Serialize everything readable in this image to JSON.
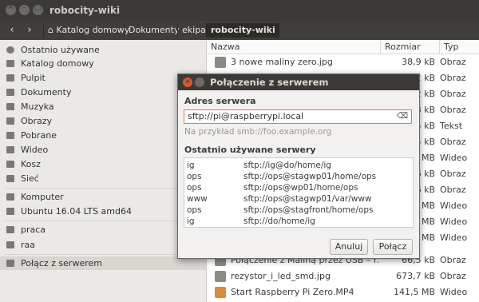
{
  "window": {
    "title": "robocity-wiki"
  },
  "pathbar": {
    "back": "‹",
    "forward": "›",
    "crumbs": [
      "Katalog domowy",
      "Dokumenty",
      "ekipa",
      "robocity-wiki"
    ]
  },
  "sidebar": {
    "items": [
      {
        "label": "Ostatnio używane",
        "icon": "clock-icon"
      },
      {
        "label": "Katalog domowy",
        "icon": "home-icon"
      },
      {
        "label": "Pulpit",
        "icon": "folder-icon"
      },
      {
        "label": "Dokumenty",
        "icon": "folder-icon"
      },
      {
        "label": "Muzyka",
        "icon": "folder-icon"
      },
      {
        "label": "Obrazy",
        "icon": "folder-icon"
      },
      {
        "label": "Pobrane",
        "icon": "download-icon"
      },
      {
        "label": "Wideo",
        "icon": "video-icon"
      },
      {
        "label": "Kosz",
        "icon": "trash-icon"
      },
      {
        "label": "Sieć",
        "icon": "network-icon"
      },
      {
        "label": "Komputer",
        "icon": "computer-icon"
      },
      {
        "label": "Ubuntu 16.04 LTS amd64",
        "icon": "disk-icon"
      },
      {
        "label": "praca",
        "icon": "folder-icon"
      },
      {
        "label": "raa",
        "icon": "folder-icon"
      },
      {
        "label": "Połącz z serwerem",
        "icon": "server-icon"
      }
    ]
  },
  "files": {
    "headers": {
      "name": "Nazwa",
      "size": "Rozmiar",
      "type": "Typ"
    },
    "rows": [
      {
        "name": "3 nowe maliny zero.jpg",
        "size": "38,9 kB",
        "type": "Obraz"
      },
      {
        "name": "",
        "size": "2 kB",
        "type": "Obraz"
      },
      {
        "name": "",
        "size": "2 kB",
        "type": "Obraz"
      },
      {
        "name": "",
        "size": "8 kB",
        "type": "Obraz"
      },
      {
        "name": "",
        "size": "5 kB",
        "type": "Tekst"
      },
      {
        "name": "",
        "size": "5 kB",
        "type": "Obraz"
      },
      {
        "name": "",
        "size": "6 MB",
        "type": "Wideo"
      },
      {
        "name": "",
        "size": "6 kB",
        "type": "Obraz"
      },
      {
        "name": "",
        "size": "6 kB",
        "type": "Obraz"
      },
      {
        "name": "",
        "size": "7 MB",
        "type": "Wideo"
      },
      {
        "name": "",
        "size": "4 MB",
        "type": "Wideo"
      },
      {
        "name": "",
        "size": "8 MB",
        "type": "Wideo"
      },
      {
        "name": "Połączenie z Maliną przez USB – r...",
        "size": "66,5 kB",
        "type": "Obraz"
      },
      {
        "name": "rezystor_i_led_smd.jpg",
        "size": "673,7 kB",
        "type": "Obraz"
      },
      {
        "name": "Start Raspberry Pi Zero.MP4",
        "size": "141,5 MB",
        "type": "Wideo"
      }
    ]
  },
  "dialog": {
    "title": "Połączenie z serwerem",
    "address_label": "Adres serwera",
    "address_value": "sftp://pi@raspberrypi.local",
    "hint": "Na przykład smb://foo.example.org",
    "recent_label": "Ostatnio używane serwery",
    "servers": [
      {
        "name": "ig",
        "url": "sftp://ig@do/home/ig"
      },
      {
        "name": "ops",
        "url": "sftp://ops@stagwp01/home/ops"
      },
      {
        "name": "ops",
        "url": "sftp://ops@wp01/home/ops"
      },
      {
        "name": "www",
        "url": "sftp://ops@stagwp01/var/www"
      },
      {
        "name": "ops",
        "url": "sftp://ops@stagfront/home/ops"
      },
      {
        "name": "ig",
        "url": "sftp://do/home/ig"
      }
    ],
    "cancel_label": "Anuluj",
    "connect_label": "Połącz"
  }
}
